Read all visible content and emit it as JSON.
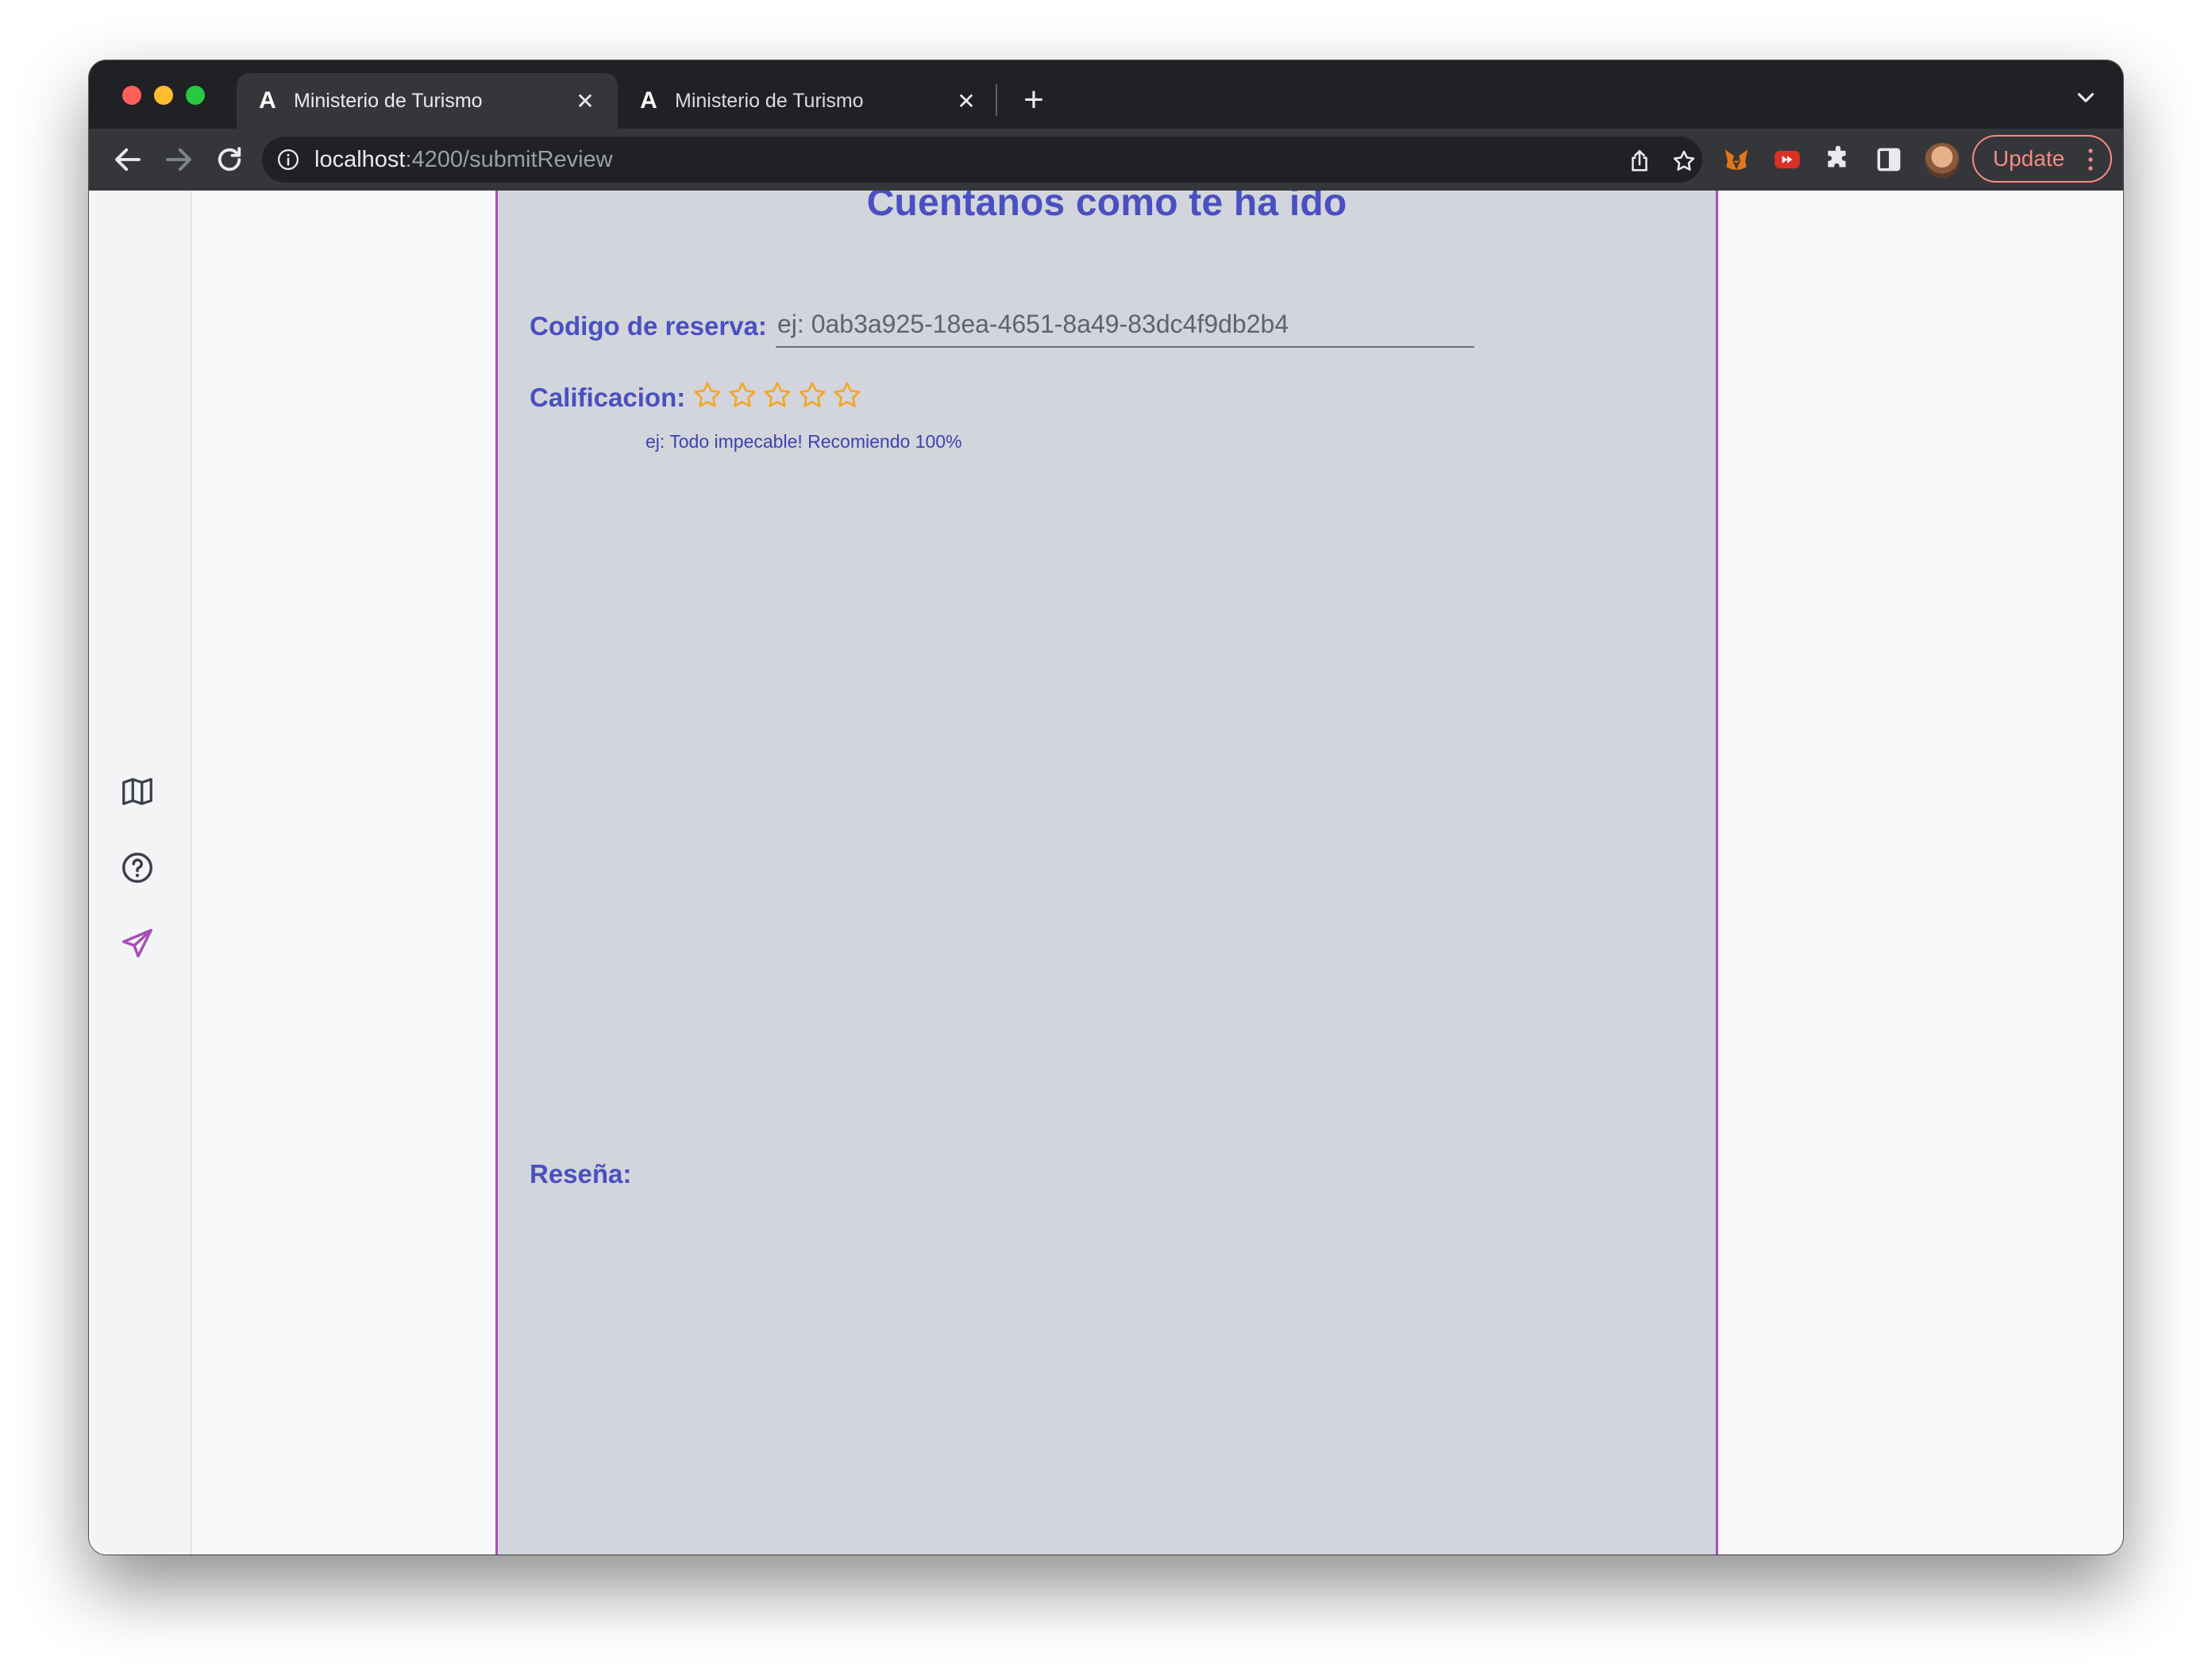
{
  "browser": {
    "tabs": [
      {
        "favicon": "A",
        "title": "Ministerio de Turismo",
        "close": "✕"
      },
      {
        "favicon": "A",
        "title": "Ministerio de Turismo",
        "close": "✕"
      }
    ],
    "new_tab": "+",
    "url_host": "localhost",
    "url_path": ":4200/submitReview",
    "update_label": "Update",
    "colors": {
      "frame": "#202124",
      "toolbar": "#35363a",
      "update": "#f28b82"
    }
  },
  "sidebar": {
    "items": [
      {
        "icon": "map-icon"
      },
      {
        "icon": "help-circle-icon"
      },
      {
        "icon": "send-icon",
        "active": true
      }
    ]
  },
  "form": {
    "title": "Cuentanos como te ha ido",
    "code_label": "Codigo de reserva:",
    "code_placeholder": "ej: 0ab3a925-18ea-4651-8a49-83dc4f9db2b4",
    "rating_label": "Calificacion:",
    "rating": {
      "value": 0,
      "max": 5
    },
    "review_hint": "ej: Todo impecable! Recomiendo 100%",
    "review_label": "Reseña:",
    "colors": {
      "accent": "#4a4fc2",
      "panel": "#d2d5db",
      "border": "#a64fb5",
      "star": "#f5a623"
    }
  }
}
